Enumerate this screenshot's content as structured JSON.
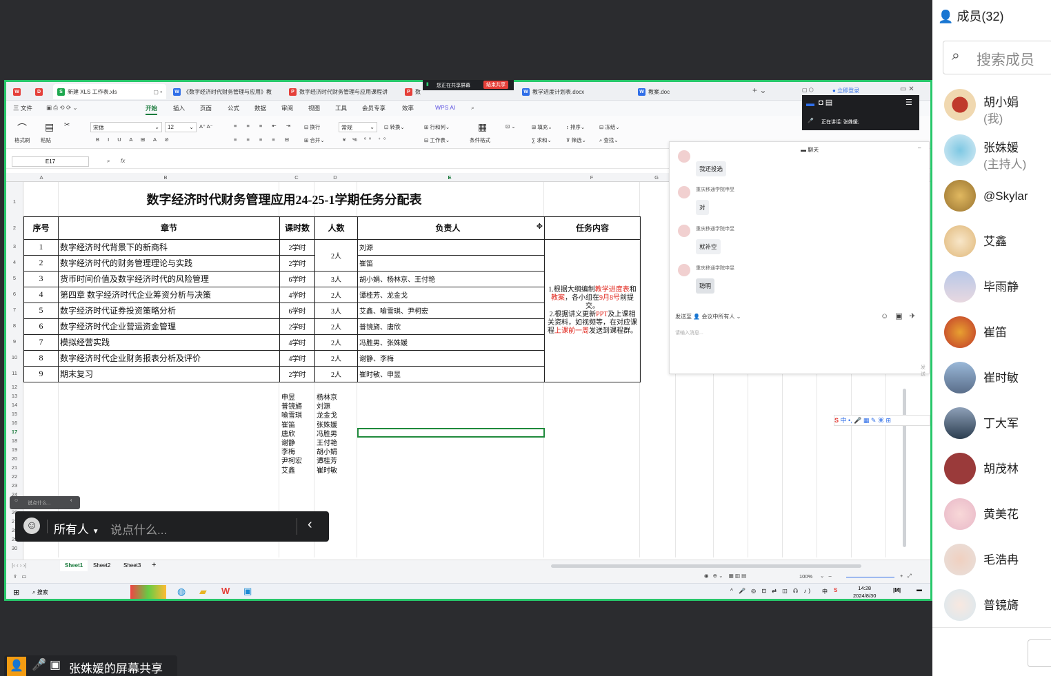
{
  "members_panel": {
    "title": "成员(32)",
    "search_placeholder": "搜索成员",
    "members": [
      {
        "name": "胡小娟",
        "sub": "(我)"
      },
      {
        "name": "张姝媛",
        "sub": "(主持人)"
      },
      {
        "name": "@Skylar",
        "sub": ""
      },
      {
        "name": "艾鑫",
        "sub": ""
      },
      {
        "name": "毕雨静",
        "sub": ""
      },
      {
        "name": "崔笛",
        "sub": ""
      },
      {
        "name": "崔时敏",
        "sub": ""
      },
      {
        "name": "丁大军",
        "sub": ""
      },
      {
        "name": "胡茂林",
        "sub": ""
      },
      {
        "name": "黄美花",
        "sub": ""
      },
      {
        "name": "毛浩冉",
        "sub": ""
      },
      {
        "name": "普镜旖",
        "sub": ""
      }
    ]
  },
  "share_indicator": {
    "sharing_text": "您正在共享屏幕",
    "end_label": "结束共享"
  },
  "tabs": [
    {
      "label": "新建 XLS 工作表.xls",
      "icon": "S"
    },
    {
      "label": "《数字经济时代财务管理与应用》教",
      "icon": "W"
    },
    {
      "label": "数字经济时代财务管理与应用课程讲",
      "icon": "P"
    },
    {
      "label": "数",
      "icon": "P"
    },
    {
      "label": "教学进度计划表.docx",
      "icon": "W"
    },
    {
      "label": "教案.doc",
      "icon": "W"
    }
  ],
  "login_label": "立即登录",
  "menu": [
    "三 文件",
    "开始",
    "插入",
    "页面",
    "公式",
    "数据",
    "审阅",
    "视图",
    "工具",
    "会员专享",
    "效率",
    "WPS AI"
  ],
  "ribbon": {
    "font_name": "宋体",
    "font_size": "12",
    "number_format": "常规",
    "labels": [
      "格式刷",
      "粘贴",
      "换行",
      "合并",
      "转换",
      "行和列",
      "工作表",
      "条件格式",
      "填充",
      "排序",
      "冻结",
      "求和",
      "筛选",
      "查找"
    ]
  },
  "formula_bar": {
    "cell_ref": "E17",
    "fx": "fx"
  },
  "columns": [
    "A",
    "B",
    "C",
    "D",
    "E",
    "F",
    "G"
  ],
  "rows": [
    "1",
    "2",
    "3",
    "4",
    "5",
    "6",
    "7",
    "8",
    "9",
    "10",
    "11",
    "12",
    "13",
    "14",
    "15",
    "16",
    "17",
    "18",
    "19",
    "20",
    "21",
    "22",
    "23",
    "24",
    "25",
    "26",
    "27",
    "28",
    "29",
    "30"
  ],
  "spreadsheet": {
    "title": "数字经济时代财务管理应用24-25-1学期任务分配表",
    "headers": [
      "序号",
      "章节",
      "课时数",
      "人数",
      "负责人",
      "任务内容"
    ],
    "rows": [
      {
        "no": "1",
        "chapter": "数字经济时代背景下的新商科",
        "hours": "2学时",
        "people": "2人",
        "owner": "刘源"
      },
      {
        "no": "2",
        "chapter": "数字经济时代的财务管理理论与实践",
        "hours": "2学时",
        "people": "",
        "owner": "崔笛"
      },
      {
        "no": "3",
        "chapter": "货币时间价值及数字经济时代的风险管理",
        "hours": "6学时",
        "people": "3人",
        "owner": "胡小娟、杨林京、王付艳"
      },
      {
        "no": "4",
        "chapter": "第四章 数字经济时代企业筹资分析与决策",
        "hours": "4学时",
        "people": "2人",
        "owner": "谭桂芳、龙金戈"
      },
      {
        "no": "5",
        "chapter": "数字经济时代证券投资策略分析",
        "hours": "6学时",
        "people": "3人",
        "owner": "艾鑫、喻雪琪、尹柯宏"
      },
      {
        "no": "6",
        "chapter": "数字经济时代企业营运资金管理",
        "hours": "2学时",
        "people": "2人",
        "owner": "普镜旖、唐欣"
      },
      {
        "no": "7",
        "chapter": "模拟经营实践",
        "hours": "4学时",
        "people": "2人",
        "owner": "冯胜男、张姝媛"
      },
      {
        "no": "8",
        "chapter": "数字经济时代企业财务报表分析及评价",
        "hours": "4学时",
        "people": "2人",
        "owner": "谢静、李梅"
      },
      {
        "no": "9",
        "chapter": "期末复习",
        "hours": "2学时",
        "people": "2人",
        "owner": "崔时敏、申昱"
      }
    ],
    "task_text": {
      "p1a": "1.根据大纲编制",
      "p1b": "教学进度表",
      "p1c": "和",
      "p1d": "教案",
      "p1e": "，各小组在",
      "p1f": "9月8号",
      "p1g": "前提交。",
      "p2a": "2.根据讲义更新",
      "p2b": "PPT",
      "p2c": "及上课相关资料，如视频等，在对应课程",
      "p2d": "上课前一周",
      "p2e": "发送到课程群。"
    },
    "names_col1": [
      "申昱",
      "普镜旖",
      "喻雪琪",
      "崔笛",
      "唐欣",
      "谢静",
      "李梅",
      "尹柯宏",
      "艾鑫"
    ],
    "names_col2": [
      "杨林京",
      "刘源",
      "龙金戈",
      "张姝媛",
      "冯胜男",
      "王付艳",
      "胡小娟",
      "谭桂芳",
      "崔时敏"
    ]
  },
  "chat": {
    "title": "聊天",
    "messages": [
      {
        "sender": "",
        "text": "我还投选"
      },
      {
        "sender": "重庆移通学院申昱",
        "text": "对"
      },
      {
        "sender": "重庆移通学院申昱",
        "text": "就补空"
      },
      {
        "sender": "重庆移通学院申昱",
        "text": "聪明"
      }
    ],
    "send_to_label": "发送至",
    "send_to_target": "会议中所有人",
    "input_placeholder": "请输入消息...",
    "send_label": "发送"
  },
  "float_bar": {
    "speaking_label": "正在讲话:",
    "speaker": "张姝媛;"
  },
  "sheet_tabs": [
    "Sheet1",
    "Sheet2",
    "Sheet3"
  ],
  "status": {
    "zoom": "100%"
  },
  "taskbar": {
    "search_label": "搜索",
    "time": "14:28",
    "date": "2024/8/30",
    "ime": "中"
  },
  "say_box": {
    "audience": "所有人",
    "placeholder": "说点什么..."
  },
  "mini_say": {
    "placeholder": "说点什么..."
  },
  "bottom_share": {
    "label": "张姝媛的屏幕共享"
  }
}
